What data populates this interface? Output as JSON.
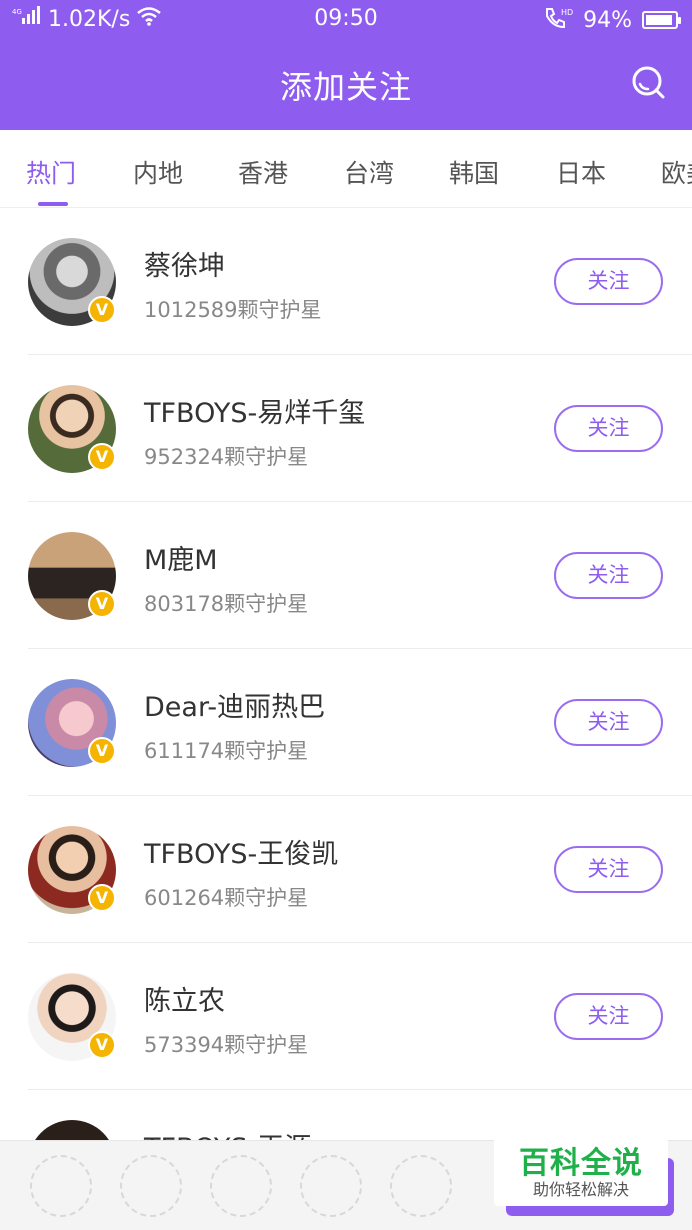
{
  "status_bar": {
    "network": "4G",
    "speed": "1.02K/s",
    "time": "09:50",
    "call_hd": "HD",
    "battery": "94%",
    "battery_level": 0.94
  },
  "header": {
    "title": "添加关注",
    "search_icon": "search-icon"
  },
  "tabs": [
    "热门",
    "内地",
    "香港",
    "台湾",
    "韩国",
    "日本",
    "欧美"
  ],
  "active_tab": "热门",
  "follow_label": "关注",
  "verified_badge": "V",
  "stars": [
    {
      "name": "蔡徐坤",
      "fans": "1012589颗守护星"
    },
    {
      "name": "TFBOYS-易烊千玺",
      "fans": "952324颗守护星"
    },
    {
      "name": "M鹿M",
      "fans": "803178颗守护星"
    },
    {
      "name": "Dear-迪丽热巴",
      "fans": "611174颗守护星"
    },
    {
      "name": "TFBOYS-王俊凯",
      "fans": "601264颗守护星"
    },
    {
      "name": "陈立农",
      "fans": "573394颗守护星"
    },
    {
      "name": "TFBOYS-王源",
      "fans": ""
    }
  ],
  "watermark": {
    "title": "百科全说",
    "subtitle": "助你轻松解决"
  },
  "colors": {
    "accent": "#8f5cf0",
    "badge": "#f4b400",
    "watermark_green": "#20b04a"
  }
}
